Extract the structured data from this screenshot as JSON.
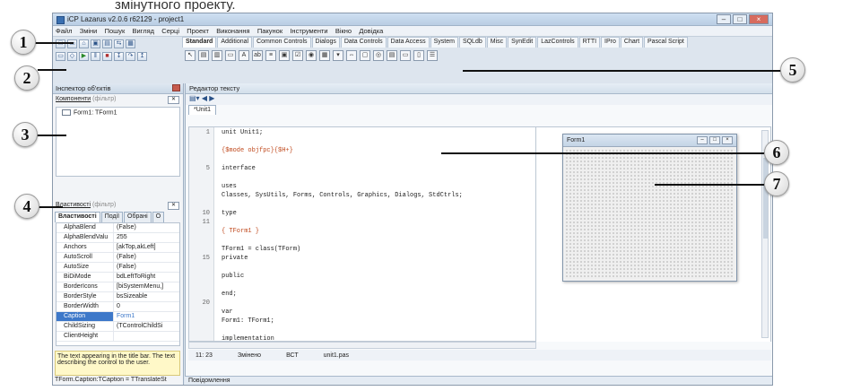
{
  "caption_text": "змінутного проекту.",
  "window": {
    "title": "iCP Lazarus v2.0.6 r62129 - project1"
  },
  "menu": [
    "Файл",
    "Зміни",
    "Пошук",
    "Вигляд",
    "Серці",
    "Проект",
    "Виконання",
    "Пакунок",
    "Інструменти",
    "Вікно",
    "Довідка"
  ],
  "palette_tabs": [
    "Standard",
    "Additional",
    "Common Controls",
    "Dialogs",
    "Data Controls",
    "Data Access",
    "System",
    "SQLdb",
    "Misc",
    "SynEdit",
    "LazControls",
    "RTTI",
    "IPro",
    "Chart",
    "Pascal Script"
  ],
  "inspector": {
    "title": "Інспектор об'єктів",
    "components_label": "Компоненти",
    "filter_placeholder": "(фільтр)",
    "tree_node": "Form1: TForm1",
    "properties_label": "Властивості",
    "tabs": [
      "Властивості",
      "Події",
      "Обрані",
      "О"
    ],
    "properties": [
      {
        "name": "AlphaBlend",
        "value": "(False)"
      },
      {
        "name": "AlphaBlendValu",
        "value": "255"
      },
      {
        "name": "Anchors",
        "value": "[akTop,akLeft]"
      },
      {
        "name": "AutoScroll",
        "value": "(False)"
      },
      {
        "name": "AutoSize",
        "value": "(False)"
      },
      {
        "name": "BiDiMode",
        "value": "bdLeftToRight"
      },
      {
        "name": "BorderIcons",
        "value": "[biSystemMenu,]"
      },
      {
        "name": "BorderStyle",
        "value": "bsSizeable"
      },
      {
        "name": "BorderWidth",
        "value": "0"
      },
      {
        "name": "Caption",
        "value": "Form1",
        "selected": true
      },
      {
        "name": "ChildSizing",
        "value": "(TControlChildSi"
      },
      {
        "name": "ClientHeight",
        "value": ""
      }
    ],
    "hint": "The text appearing in the title bar. The text describing the control to the user.",
    "hint2": "TForm.Caption:TCaption = TTranslateSt"
  },
  "editor": {
    "title": "Редактор тексту",
    "tab": "*Unit1",
    "lines": [
      {
        "n": "1",
        "text": "unit Unit1;"
      },
      {
        "n": "",
        "text": ""
      },
      {
        "n": "",
        "text": "{$mode objfpc}{$H+}",
        "kind": "directive"
      },
      {
        "n": "",
        "text": ""
      },
      {
        "n": "5",
        "text": "interface"
      },
      {
        "n": "",
        "text": ""
      },
      {
        "n": "",
        "text": "uses"
      },
      {
        "n": "",
        "text": "  Classes, SysUtils, Forms, Controls, Graphics, Dialogs, StdCtrls;"
      },
      {
        "n": "",
        "text": ""
      },
      {
        "n": "10",
        "text": "type"
      },
      {
        "n": "11",
        "text": ""
      },
      {
        "n": "",
        "text": "  { TForm1 }"
      },
      {
        "n": "",
        "text": ""
      },
      {
        "n": "",
        "text": "  TForm1 = class(TForm)"
      },
      {
        "n": "15",
        "text": "  private"
      },
      {
        "n": "",
        "text": ""
      },
      {
        "n": "",
        "text": "  public"
      },
      {
        "n": "",
        "text": ""
      },
      {
        "n": "",
        "text": "  end;"
      },
      {
        "n": "20",
        "text": ""
      },
      {
        "n": "",
        "text": "var"
      },
      {
        "n": "",
        "text": "  Form1: TForm1;"
      },
      {
        "n": "",
        "text": ""
      },
      {
        "n": "",
        "text": "implementation"
      }
    ],
    "status": {
      "pos": "11: 23",
      "state": "Змінено",
      "mode": "ВСТ",
      "file": "unit1.pas"
    },
    "messages": "Повідомлення"
  },
  "form": {
    "title": "Form1"
  },
  "callouts": [
    "1",
    "2",
    "3",
    "4",
    "5",
    "6",
    "7"
  ]
}
